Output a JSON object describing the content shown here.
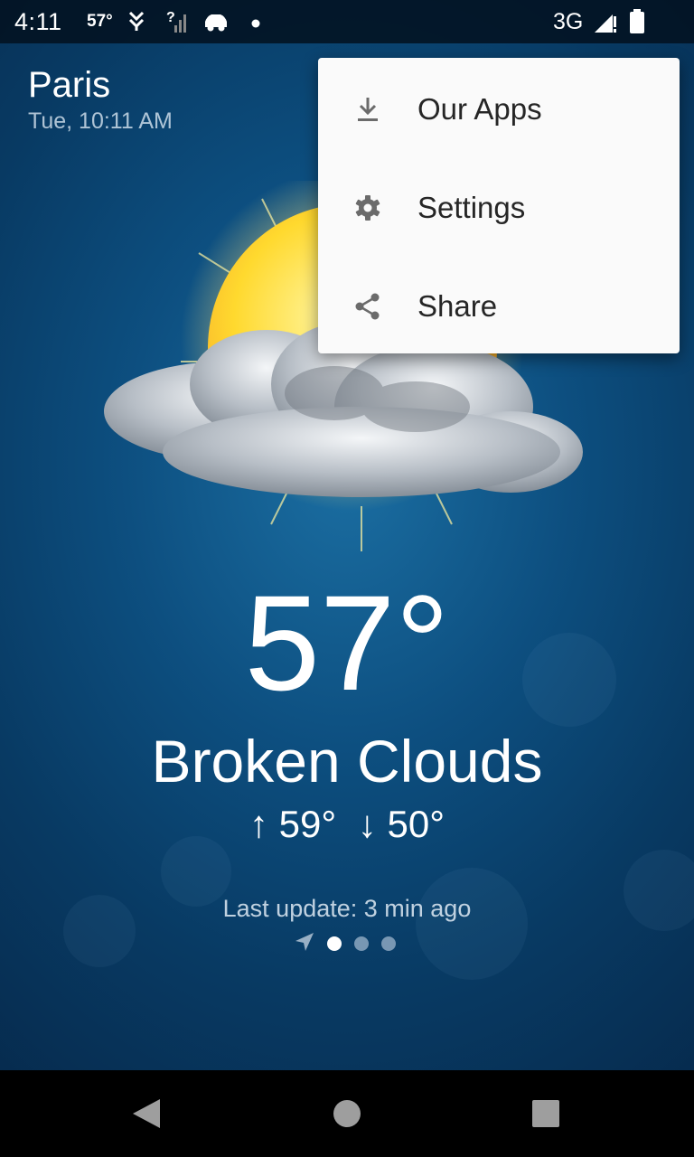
{
  "status_bar": {
    "time": "4:11",
    "temp": "57°",
    "network": "3G"
  },
  "location": {
    "city": "Paris",
    "datetime": "Tue, 10:11 AM"
  },
  "weather": {
    "temperature": "57°",
    "condition": "Broken Clouds",
    "high": "↑ 59°",
    "low": "↓ 50°",
    "last_update": "Last update: 3 min ago",
    "icon": "partly-cloudy-sun-icon"
  },
  "pager": {
    "pages": 3,
    "active_index": 0
  },
  "menu": {
    "items": [
      {
        "label": "Our Apps",
        "icon": "download-icon"
      },
      {
        "label": "Settings",
        "icon": "gear-icon"
      },
      {
        "label": "Share",
        "icon": "share-icon"
      }
    ]
  },
  "colors": {
    "accent_sun": "#FFD23A",
    "background_top": "#1b6fa3",
    "background_bottom": "#06284a"
  }
}
